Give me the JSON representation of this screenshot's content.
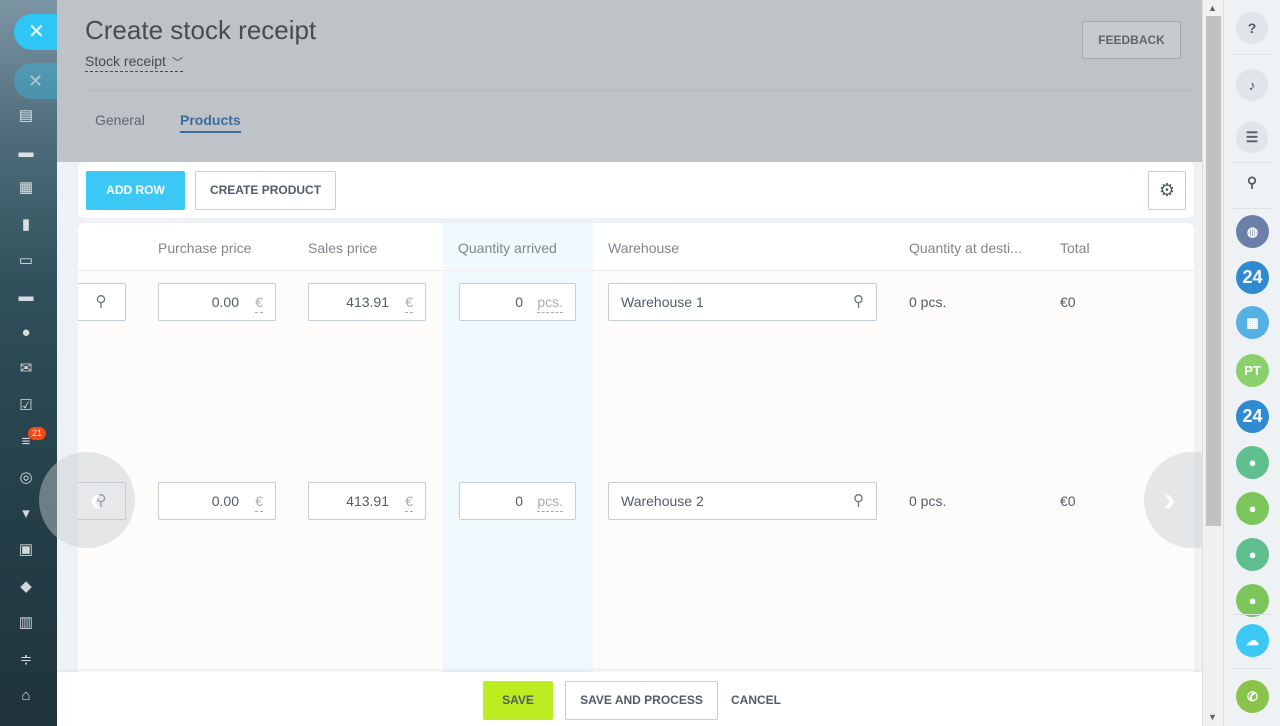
{
  "header": {
    "title": "Create stock receipt",
    "doc_type": "Stock receipt",
    "feedback_label": "FEEDBACK"
  },
  "tabs": [
    {
      "label": "General",
      "active": false
    },
    {
      "label": "Products",
      "active": true
    }
  ],
  "toolbar": {
    "add_row_label": "ADD ROW",
    "create_product_label": "CREATE PRODUCT"
  },
  "table": {
    "columns": [
      "Purchase price",
      "Sales price",
      "Quantity arrived",
      "Warehouse",
      "Quantity at desti...",
      "Total"
    ],
    "rows": [
      {
        "purchase_price": "0.00",
        "purchase_currency": "€",
        "sales_price": "413.91",
        "sales_currency": "€",
        "quantity": "0",
        "quantity_unit": "pcs.",
        "warehouse": "Warehouse 1",
        "qty_destination": "0 pcs.",
        "total": "€0"
      },
      {
        "purchase_price": "0.00",
        "purchase_currency": "€",
        "sales_price": "413.91",
        "sales_currency": "€",
        "quantity": "0",
        "quantity_unit": "pcs.",
        "warehouse": "Warehouse 2",
        "qty_destination": "0 pcs.",
        "total": "€0"
      }
    ]
  },
  "footer": {
    "save_label": "SAVE",
    "save_process_label": "SAVE AND PROCESS",
    "cancel_label": "CANCEL"
  },
  "left_sidebar": {
    "close_icon": "close-icon",
    "counter_badge": "21"
  },
  "right_sidebar": {
    "avatar_initials": "PT",
    "badge_24a": "24",
    "badge_24b": "24"
  },
  "colors": {
    "accent_blue": "#3bc8f5",
    "save_green": "#bbed21",
    "link_blue": "#2067b0"
  }
}
